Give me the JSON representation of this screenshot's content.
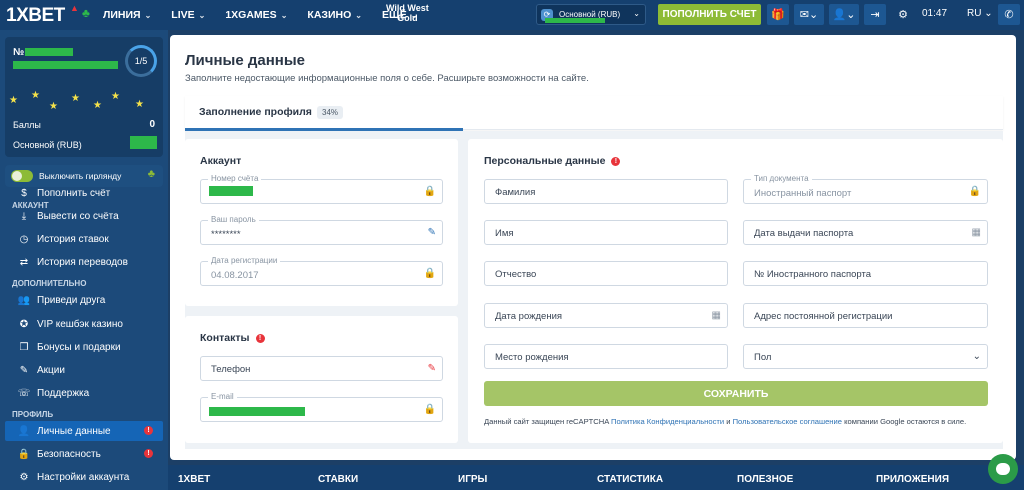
{
  "header": {
    "logo_prefix": "1X",
    "logo_suffix": "BET",
    "nav": [
      {
        "label": "ЛИНИЯ",
        "dropdown": true
      },
      {
        "label": "LIVE",
        "dropdown": true
      },
      {
        "label": "1XGAMES",
        "dropdown": true
      },
      {
        "label": "КАЗИНО",
        "dropdown": true
      },
      {
        "label": "ЕЩЁ",
        "dropdown": true
      }
    ],
    "promo_line1": "Wild West",
    "promo_line2": "Gold",
    "balance_selector": "Основной (RUB)",
    "deposit_button": "ПОПОЛНИТЬ СЧЕТ",
    "time": "01:47",
    "language": "RU",
    "icons": [
      "gift-icon",
      "mail-icon",
      "user-icon",
      "logout-icon",
      "settings-icon",
      "phone-icon"
    ]
  },
  "sidebar": {
    "profile": {
      "number_prefix": "№",
      "level": "1/5",
      "points_label": "Баллы",
      "points_value": "0",
      "balance_label": "Основной (RUB)"
    },
    "garland_toggle_label": "Выключить гирлянду",
    "sections": {
      "account": "АККАУНТ",
      "additional": "ДОПОЛНИТЕЛЬНО",
      "profile": "ПРОФИЛЬ"
    },
    "items": {
      "deposit": {
        "label": "Пополнить счёт",
        "icon": "dollar-icon"
      },
      "withdraw": {
        "label": "Вывести со счёта",
        "icon": "withdraw-icon"
      },
      "bet_history": {
        "label": "История ставок",
        "icon": "history-icon"
      },
      "transfer_history": {
        "label": "История переводов",
        "icon": "transfer-icon"
      },
      "invite": {
        "label": "Приведи друга",
        "icon": "friends-icon"
      },
      "vip": {
        "label": "VIP кешбэк казино",
        "icon": "vip-icon"
      },
      "bonuses": {
        "label": "Бонусы и подарки",
        "icon": "gift-icon"
      },
      "promotions": {
        "label": "Акции",
        "icon": "promo-icon"
      },
      "support": {
        "label": "Поддержка",
        "icon": "support-icon"
      },
      "personal": {
        "label": "Личные данные",
        "icon": "person-icon",
        "warning": "!"
      },
      "security": {
        "label": "Безопасность",
        "icon": "lock-icon",
        "warning": "!"
      },
      "settings": {
        "label": "Настройки аккаунта",
        "icon": "gear-icon"
      }
    }
  },
  "main": {
    "title": "Личные данные",
    "subtitle": "Заполните недостающие информационные поля о себе. Расширьте возможности на сайте.",
    "tab_label": "Заполнение профиля",
    "progress_percent": "34%",
    "account": {
      "title": "Аккаунт",
      "account_number_label": "Номер счёта",
      "password_label": "Ваш пароль",
      "password_value": "********",
      "reg_date_label": "Дата регистрации",
      "reg_date_value": "04.08.2017"
    },
    "contacts": {
      "title": "Контакты",
      "warning": "!",
      "phone_placeholder": "Телефон",
      "email_label": "E-mail"
    },
    "personal": {
      "title": "Персональные данные",
      "warning": "!",
      "last_name": "Фамилия",
      "first_name": "Имя",
      "patronymic": "Отчество",
      "birth_date": "Дата рождения",
      "birth_place": "Место рождения",
      "doc_type_label": "Тип документа",
      "doc_type_value": "Иностранный паспорт",
      "passport_issue_date": "Дата выдачи паспорта",
      "passport_number": "№ Иностранного паспорта",
      "address": "Адрес постоянной регистрации",
      "gender": "Пол"
    },
    "save_button": "СОХРАНИТЬ",
    "captcha_text_1": "Данный сайт защищен reCAPTCHA",
    "captcha_link_1": "Политика Конфиденциальности",
    "captcha_and": "и",
    "captcha_link_2": "Пользовательское соглашение",
    "captcha_text_2": "компании Google остаются в силе."
  },
  "footer": {
    "items": [
      "1XBET",
      "СТАВКИ",
      "ИГРЫ",
      "СТАТИСТИКА",
      "ПОЛЕЗНОЕ",
      "ПРИЛОЖЕНИЯ"
    ]
  },
  "colors": {
    "header_bg": "#15406f",
    "sidebar_bg": "#1c4a7a",
    "accent_green": "#8dbb36",
    "active_blue": "#1565b6",
    "warning_red": "#e8343b",
    "hidden_data_green": "#2db84a"
  }
}
